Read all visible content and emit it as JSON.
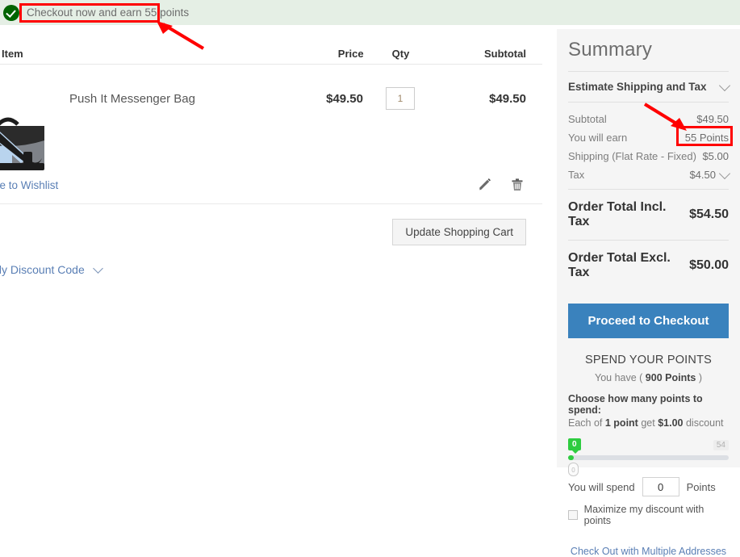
{
  "banner": {
    "icon": "success-check-icon",
    "message": "Checkout now and earn 55 points"
  },
  "cart": {
    "columns": {
      "item": "Item",
      "price": "Price",
      "qty": "Qty",
      "subtotal": "Subtotal"
    },
    "items": [
      {
        "name": "Push It Messenger Bag",
        "price": "$49.50",
        "qty": "1",
        "subtotal": "$49.50",
        "wishlist_label": "Move to Wishlist",
        "edit_icon": "pencil-edit-icon",
        "remove_icon": "trash-delete-icon"
      }
    ],
    "update_button": "Update Shopping Cart",
    "discount_link": "Apply Discount Code"
  },
  "summary": {
    "title": "Summary",
    "estimate_label": "Estimate Shipping and Tax",
    "rows": [
      {
        "label": "Subtotal",
        "value": "$49.50"
      },
      {
        "label": "You will earn",
        "value": "55 Points"
      },
      {
        "label": "Shipping (Flat Rate - Fixed)",
        "value": "$5.00"
      },
      {
        "label": "Tax",
        "value": "$4.50"
      }
    ],
    "grand_totals": [
      {
        "label": "Order Total Incl. Tax",
        "value": "$54.50"
      },
      {
        "label": "Order Total Excl. Tax",
        "value": "$50.00"
      }
    ],
    "checkout_button": "Proceed to Checkout",
    "points": {
      "heading": "SPEND YOUR POINTS",
      "have_prefix": "You have (",
      "have_value": "900 Points",
      "have_suffix": ")",
      "choose_label": "Choose how many points to spend:",
      "each_prefix": "Each of",
      "each_point": "1 point",
      "each_mid": "get",
      "each_amount": "$1.00",
      "each_suffix": "discount",
      "slider_min": "0",
      "slider_max": "54",
      "slider_handle_value": "0",
      "spend_prefix": "You will spend",
      "spend_value": "0",
      "spend_suffix": "Points",
      "maximize_label": "Maximize my discount with points"
    },
    "multi_address_link": "Check Out with Multiple Addresses"
  },
  "colors": {
    "banner_bg": "#e5efe5",
    "success_green": "#006400",
    "summary_bg": "#f5f5f5",
    "checkout_blue": "#3a82bd",
    "link_blue": "#5a7fb5",
    "slider_green": "#2ecc40",
    "annotation_red": "#ff0000"
  }
}
